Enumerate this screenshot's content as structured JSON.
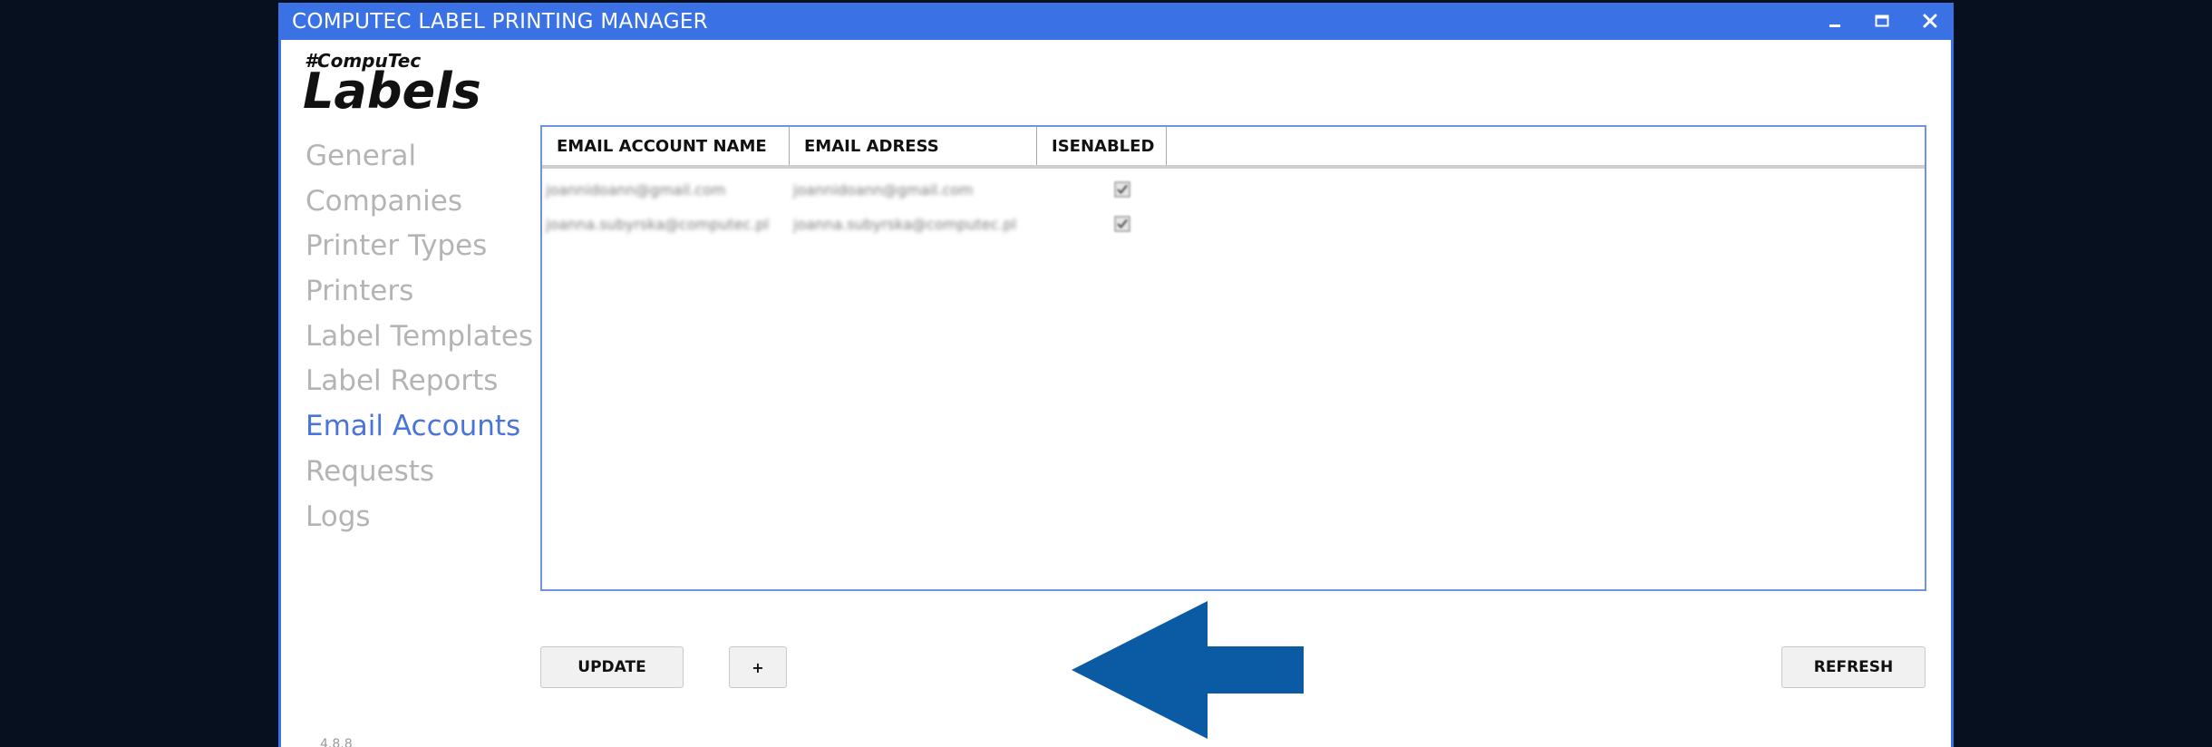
{
  "window": {
    "title": "COMPUTEC LABEL PRINTING MANAGER",
    "accent_color": "#3a72e6",
    "controls": [
      "minimize-icon",
      "maximize-icon",
      "close-icon"
    ]
  },
  "logo": {
    "small": "#CompuTec",
    "big": "Labels"
  },
  "nav": {
    "items": [
      {
        "label": "General"
      },
      {
        "label": "Companies"
      },
      {
        "label": "Printer Types"
      },
      {
        "label": "Printers"
      },
      {
        "label": "Label Templates"
      },
      {
        "label": "Label Reports"
      },
      {
        "label": "Email Accounts",
        "active": true
      },
      {
        "label": "Requests"
      },
      {
        "label": "Logs"
      }
    ],
    "active_color": "#4a74d9",
    "inactive_color": "#b4b4b4"
  },
  "grid": {
    "columns": [
      "EMAIL ACCOUNT NAME",
      "EMAIL ADRESS",
      "ISENABLED"
    ],
    "rows": [
      {
        "name": "joannidoann@gmail.com",
        "address": "joannidoann@gmail.com",
        "enabled": true
      },
      {
        "name": "joanna.subyrska@computec.pl",
        "address": "joanna.subyrska@computec.pl",
        "enabled": true
      }
    ]
  },
  "buttons": {
    "update": "UPDATE",
    "add": "+",
    "refresh": "REFRESH"
  },
  "annotation": {
    "arrow_color": "#0a5ba3",
    "points_to": "add-button"
  },
  "footer": {
    "version": "4.8.8"
  }
}
